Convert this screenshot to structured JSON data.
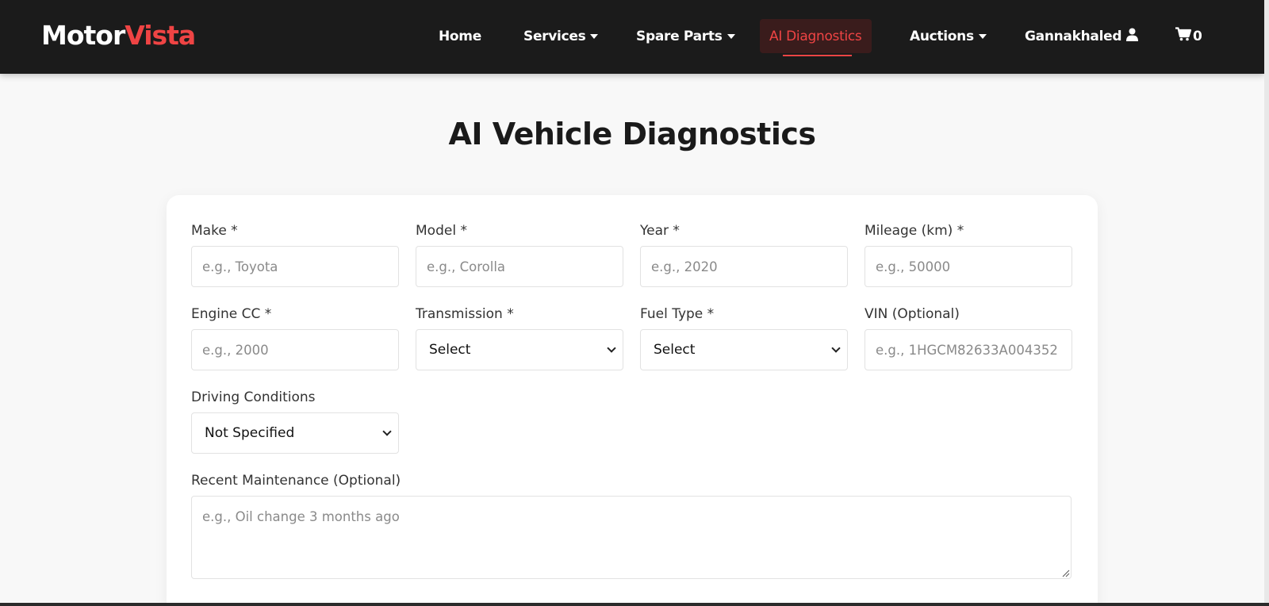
{
  "brand": {
    "part1": "Motor",
    "part2": "Vista",
    "accent_color": "#ef4444"
  },
  "nav": {
    "home": "Home",
    "services": "Services",
    "spare_parts": "Spare Parts",
    "ai_diagnostics": "AI Diagnostics",
    "auctions": "Auctions",
    "user": "Gannakhaled",
    "cart_count": "0",
    "active": "AI Diagnostics"
  },
  "page": {
    "title": "AI Vehicle Diagnostics"
  },
  "form": {
    "make": {
      "label": "Make *",
      "placeholder": "e.g., Toyota",
      "value": ""
    },
    "model": {
      "label": "Model *",
      "placeholder": "e.g., Corolla",
      "value": ""
    },
    "year": {
      "label": "Year *",
      "placeholder": "e.g., 2020",
      "value": ""
    },
    "mileage": {
      "label": "Mileage (km) *",
      "placeholder": "e.g., 50000",
      "value": ""
    },
    "engine_cc": {
      "label": "Engine CC *",
      "placeholder": "e.g., 2000",
      "value": ""
    },
    "transmission": {
      "label": "Transmission *",
      "selected": "Select"
    },
    "fuel_type": {
      "label": "Fuel Type *",
      "selected": "Select"
    },
    "vin": {
      "label": "VIN (Optional)",
      "placeholder": "e.g., 1HGCM82633A004352",
      "value": ""
    },
    "driving_conditions": {
      "label": "Driving Conditions",
      "selected": "Not Specified"
    },
    "recent_maintenance": {
      "label": "Recent Maintenance (Optional)",
      "placeholder": "e.g., Oil change 3 months ago",
      "value": ""
    }
  },
  "icons": {
    "user": "user-icon",
    "cart": "cart-icon",
    "caret": "caret-down-icon",
    "chevron": "chevron-down-icon"
  }
}
